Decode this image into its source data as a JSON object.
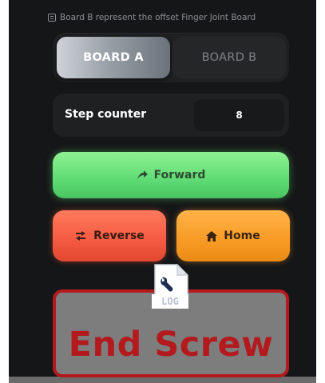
{
  "note": {
    "text": "Board B represent the offset Finger Joint Board",
    "icon": "info-note-icon"
  },
  "board_selector": {
    "options": [
      {
        "label": "BOARD A",
        "selected": true
      },
      {
        "label": "BOARD B",
        "selected": false
      }
    ]
  },
  "step_counter": {
    "label": "Step counter",
    "value": "8"
  },
  "buttons": {
    "forward": {
      "label": "Forward",
      "icon": "forward-arrow-icon"
    },
    "reverse": {
      "label": "Reverse",
      "icon": "reverse-arrow-icon"
    },
    "home": {
      "label": "Home",
      "icon": "home-icon"
    }
  },
  "end_screw": {
    "label": "End Screw"
  },
  "log_file": {
    "label": "LOG",
    "icon": "log-file-icon"
  },
  "colors": {
    "background": "#151617",
    "panel": "#1f2022",
    "forward": "#5fdc74",
    "reverse": "#f45a41",
    "home": "#f89b25",
    "end_screw_border": "#b3191d"
  }
}
